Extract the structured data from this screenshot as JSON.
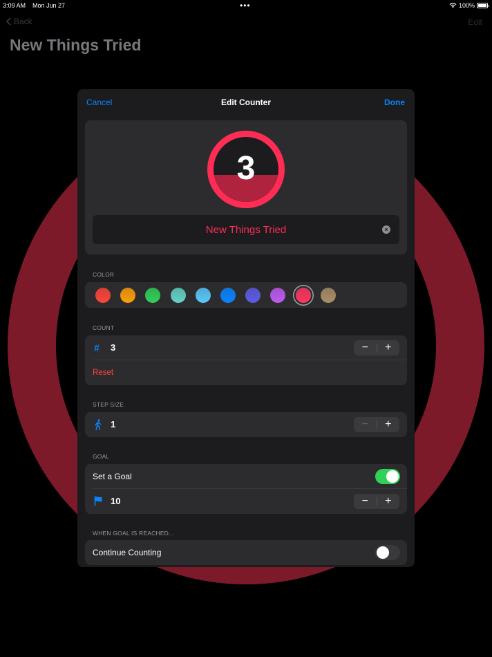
{
  "status_bar": {
    "time": "3:09 AM",
    "date": "Mon Jun 27",
    "battery": "100%"
  },
  "background": {
    "back_label": "Back",
    "edit_label": "Edit",
    "title": "New Things Tried",
    "ring_color": "#7d1a2a"
  },
  "modal": {
    "cancel_label": "Cancel",
    "title": "Edit Counter",
    "done_label": "Done",
    "preview": {
      "count": "3",
      "name": "New Things Tried",
      "fill_fraction": 0.42
    },
    "color": {
      "label": "COLOR",
      "swatches": [
        {
          "name": "red",
          "color": "#ff453a",
          "selected": false
        },
        {
          "name": "orange",
          "color": "#ff9f0a",
          "selected": false
        },
        {
          "name": "green",
          "color": "#30d158",
          "selected": false
        },
        {
          "name": "teal",
          "color": "#64d2c8",
          "selected": false
        },
        {
          "name": "cyan",
          "color": "#5ac8fa",
          "selected": false
        },
        {
          "name": "blue",
          "color": "#0a84ff",
          "selected": false
        },
        {
          "name": "indigo",
          "color": "#5e5ce6",
          "selected": false
        },
        {
          "name": "purple",
          "color": "#bf5af2",
          "selected": false
        },
        {
          "name": "pink",
          "color": "#ff375f",
          "selected": true
        },
        {
          "name": "brown",
          "color": "#ac8e68",
          "selected": false
        }
      ]
    },
    "count": {
      "label": "COUNT",
      "value": "3",
      "reset_label": "Reset"
    },
    "step_size": {
      "label": "STEP SIZE",
      "value": "1"
    },
    "goal": {
      "label": "GOAL",
      "set_goal_label": "Set a Goal",
      "set_goal_on": true,
      "value": "10"
    },
    "when_reached": {
      "label": "WHEN GOAL IS REACHED...",
      "continue_label": "Continue Counting",
      "continue_on": false
    }
  },
  "stepper": {
    "minus": "−",
    "plus": "+"
  },
  "colors": {
    "accent": "#0a84ff",
    "counter": "#ff2d55",
    "toggle_on": "#30d158",
    "toggle_off": "#39393d",
    "destructive": "#ff453a"
  }
}
